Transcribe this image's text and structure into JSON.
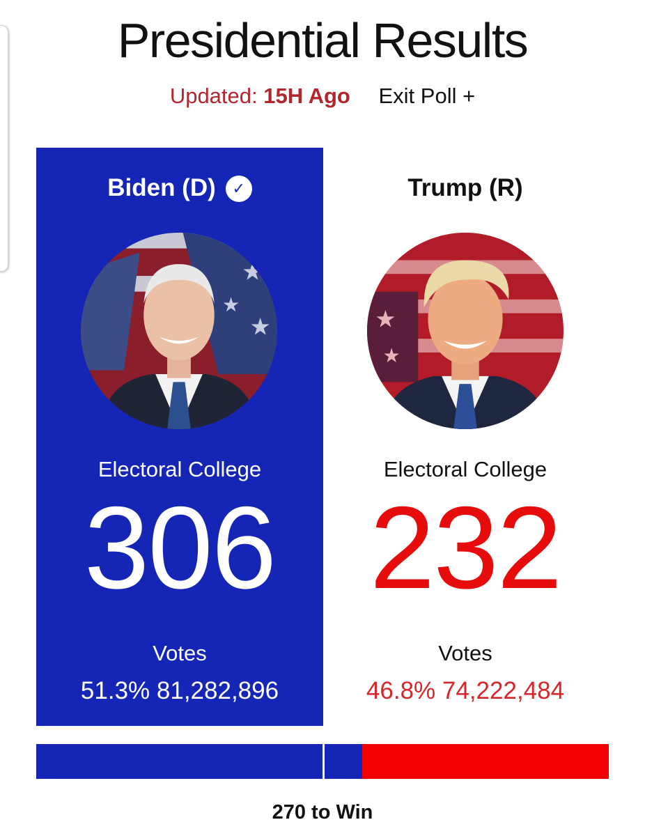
{
  "header": {
    "title": "Presidential Results",
    "updated_label": "Updated:",
    "updated_value": "15H Ago",
    "exit_poll": "Exit Poll +"
  },
  "candidates": [
    {
      "name": "Biden (D)",
      "winner": true,
      "electoral_label": "Electoral College",
      "electoral_votes": "306",
      "votes_label": "Votes",
      "vote_pct": "51.3%",
      "vote_count": "81,282,896",
      "panel_color": "#1526b6"
    },
    {
      "name": "Trump (R)",
      "winner": false,
      "electoral_label": "Electoral College",
      "electoral_votes": "232",
      "votes_label": "Votes",
      "vote_pct": "46.8%",
      "vote_count": "74,222,484",
      "accent_color": "#e60c0c"
    }
  ],
  "electoral_bar": {
    "total": 538,
    "democrat": 306,
    "republican": 232,
    "threshold": 270,
    "threshold_label": "270 to Win",
    "colors": {
      "democrat": "#1526b6",
      "republican": "#f20000"
    }
  },
  "icons": {
    "winner_check": "checkmark-icon"
  }
}
